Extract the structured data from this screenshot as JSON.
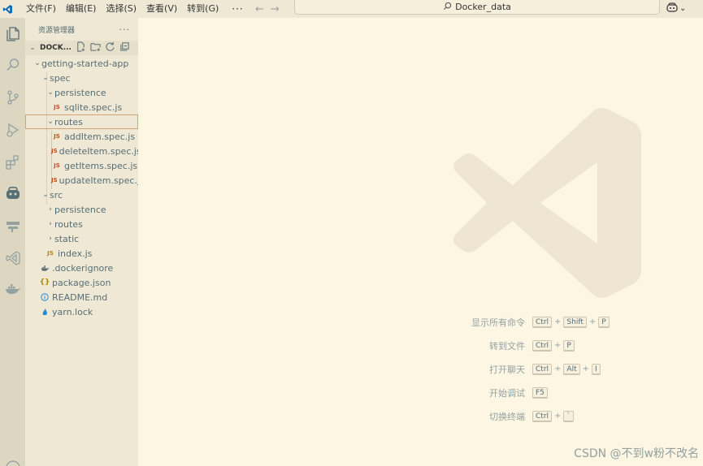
{
  "menubar": {
    "items": [
      "文件(F)",
      "编辑(E)",
      "选择(S)",
      "查看(V)",
      "转到(G)"
    ],
    "more": "···"
  },
  "command_center": {
    "text": "Docker_data"
  },
  "sidebar": {
    "title": "资源管理器",
    "more": "···",
    "section_label": "DOCK...",
    "tree": [
      {
        "label": "getting-started-app",
        "type": "folder",
        "expanded": true
      },
      {
        "label": "spec",
        "type": "folder",
        "expanded": true
      },
      {
        "label": "persistence",
        "type": "folder",
        "expanded": true
      },
      {
        "label": "sqlite.spec.js",
        "type": "js"
      },
      {
        "label": "routes",
        "type": "folder",
        "expanded": true,
        "selected": true
      },
      {
        "label": "addItem.spec.js",
        "type": "js"
      },
      {
        "label": "deleteItem.spec.js",
        "type": "js"
      },
      {
        "label": "getItems.spec.js",
        "type": "js"
      },
      {
        "label": "updateItem.spec.js",
        "type": "js"
      },
      {
        "label": "src",
        "type": "folder",
        "expanded": true
      },
      {
        "label": "persistence",
        "type": "folder",
        "expanded": false
      },
      {
        "label": "routes",
        "type": "folder",
        "expanded": false
      },
      {
        "label": "static",
        "type": "folder",
        "expanded": false
      },
      {
        "label": "index.js",
        "type": "js"
      },
      {
        "label": ".dockerignore",
        "type": "docker"
      },
      {
        "label": "package.json",
        "type": "json"
      },
      {
        "label": "README.md",
        "type": "info"
      },
      {
        "label": "yarn.lock",
        "type": "yarn"
      }
    ]
  },
  "shortcuts": [
    {
      "label": "显示所有命令",
      "keys": [
        "Ctrl",
        "Shift",
        "P"
      ]
    },
    {
      "label": "转到文件",
      "keys": [
        "Ctrl",
        "P"
      ]
    },
    {
      "label": "打开聊天",
      "keys": [
        "Ctrl",
        "Alt",
        "I"
      ]
    },
    {
      "label": "开始调试",
      "keys": [
        "F5"
      ]
    },
    {
      "label": "切换终端",
      "keys": [
        "Ctrl",
        "`"
      ]
    }
  ],
  "watermark": "CSDN @不到w粉不改名",
  "colors": {
    "accent": "#0066b8",
    "sidebar_bg": "#eee8d5",
    "editor_bg": "#fdf6e3",
    "selection_border": "#d2a278"
  }
}
